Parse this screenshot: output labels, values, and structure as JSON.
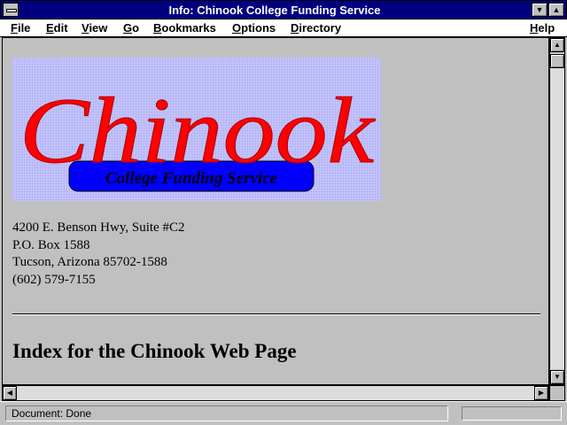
{
  "window": {
    "title": "Info: Chinook College Funding Service"
  },
  "menu": [
    {
      "key": "F",
      "rest": "ile"
    },
    {
      "key": "E",
      "rest": "dit"
    },
    {
      "key": "V",
      "rest": "iew"
    },
    {
      "key": "G",
      "rest": "o"
    },
    {
      "key": "B",
      "rest": "ookmarks"
    },
    {
      "key": "O",
      "rest": "ptions"
    },
    {
      "key": "D",
      "rest": "irectory"
    },
    {
      "key": "H",
      "rest": "elp"
    }
  ],
  "logo": {
    "wordmark": "Chinook",
    "tagline": "College Funding Service",
    "colors": {
      "background": "#c4c4ff",
      "script": "#ff0000",
      "banner": "#0000ff",
      "banner_text": "#000000"
    }
  },
  "address": {
    "line1": "4200 E. Benson Hwy, Suite #C2",
    "line2": "P.O. Box 1588",
    "line3": "Tucson, Arizona 85702-1588",
    "phone": "(602) 579-7155"
  },
  "page": {
    "heading": "Index for the Chinook Web Page"
  },
  "status": {
    "text": "Document: Done"
  },
  "icons": {
    "system_menu": "system-menu-icon",
    "minimize": "triangle-down-icon",
    "maximize": "triangle-up-icon",
    "scroll_up": "arrow-up-icon",
    "scroll_down": "arrow-down-icon",
    "scroll_left": "arrow-left-icon",
    "scroll_right": "arrow-right-icon"
  },
  "colors": {
    "titlebar": "#000080",
    "chrome": "#c0c0c0"
  }
}
